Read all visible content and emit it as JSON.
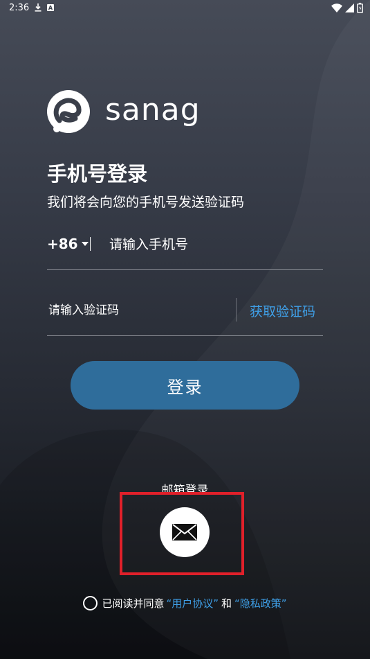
{
  "status_bar": {
    "time": "2:36",
    "download_icon": "download-icon",
    "notification_badge": "A",
    "wifi_icon": "wifi-icon",
    "signal_icon": "signal-icon",
    "battery_icon": "battery-icon"
  },
  "logo": {
    "brand_name": "sanag",
    "mark_icon": "sanag-logo-icon"
  },
  "header": {
    "title": "手机号登录",
    "subtitle": "我们将会向您的手机号发送验证码"
  },
  "phone": {
    "country_code": "+86",
    "placeholder": "请输入手机号",
    "value": ""
  },
  "verification": {
    "placeholder": "请输入验证码",
    "value": "",
    "get_code_label": "获取验证码"
  },
  "login_button": {
    "label": "登录"
  },
  "alt_login": {
    "email_label": "邮箱登录",
    "email_icon": "envelope-icon"
  },
  "agreement": {
    "prefix": "已阅读并同意",
    "user_agreement": "“用户协议”",
    "and": "和",
    "privacy_policy": "“隐私政策”",
    "checked": false
  },
  "colors": {
    "accent": "#3fa0e8",
    "button": "#2f6d9b",
    "highlight": "#e0202a"
  }
}
